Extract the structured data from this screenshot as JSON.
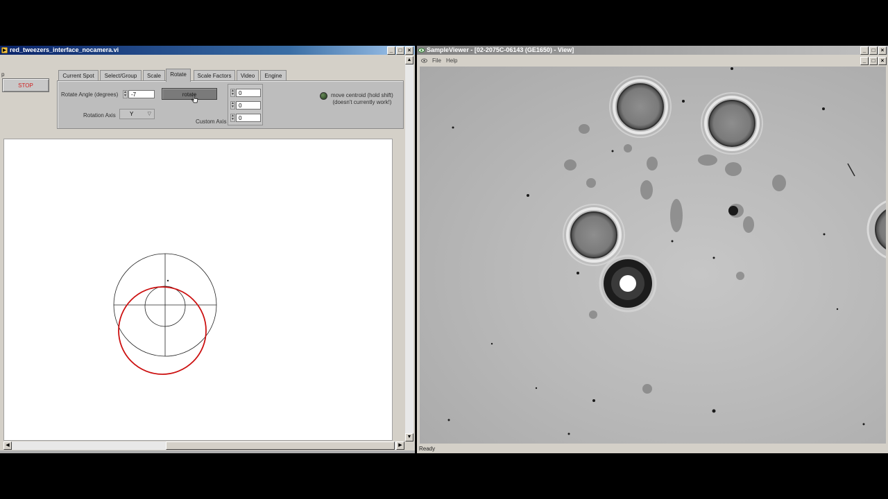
{
  "left_window": {
    "title": "red_tweezers_interface_nocamera.vi",
    "stray_label": "p",
    "stop_label": "STOP",
    "tabs": [
      {
        "label": "Current Spot"
      },
      {
        "label": "Select/Group"
      },
      {
        "label": "Scale"
      },
      {
        "label": "Rotate"
      },
      {
        "label": "Scale Factors"
      },
      {
        "label": "Video"
      },
      {
        "label": "Engine"
      }
    ],
    "active_tab": "Rotate",
    "rotate": {
      "angle_label": "Rotate Angle (degrees)",
      "angle_value": "-7",
      "rotate_button": "rotate",
      "axis_label": "Rotation Axis",
      "axis_value": "Y",
      "custom_axis_label": "Custom Axis",
      "custom_axis_values": [
        "0",
        "0",
        "0"
      ],
      "led_label_line1": "move centroid (hold shift)",
      "led_label_line2": "(doesn't currently work!)",
      "led_on": false
    },
    "colors": {
      "red_circle": "#cc1010",
      "black_circle": "#202020"
    }
  },
  "right_window": {
    "title": "SampleViewer - [02-2075C-06143 (GE1650) - View]",
    "menu": [
      "File",
      "Help"
    ],
    "status": "Ready"
  }
}
